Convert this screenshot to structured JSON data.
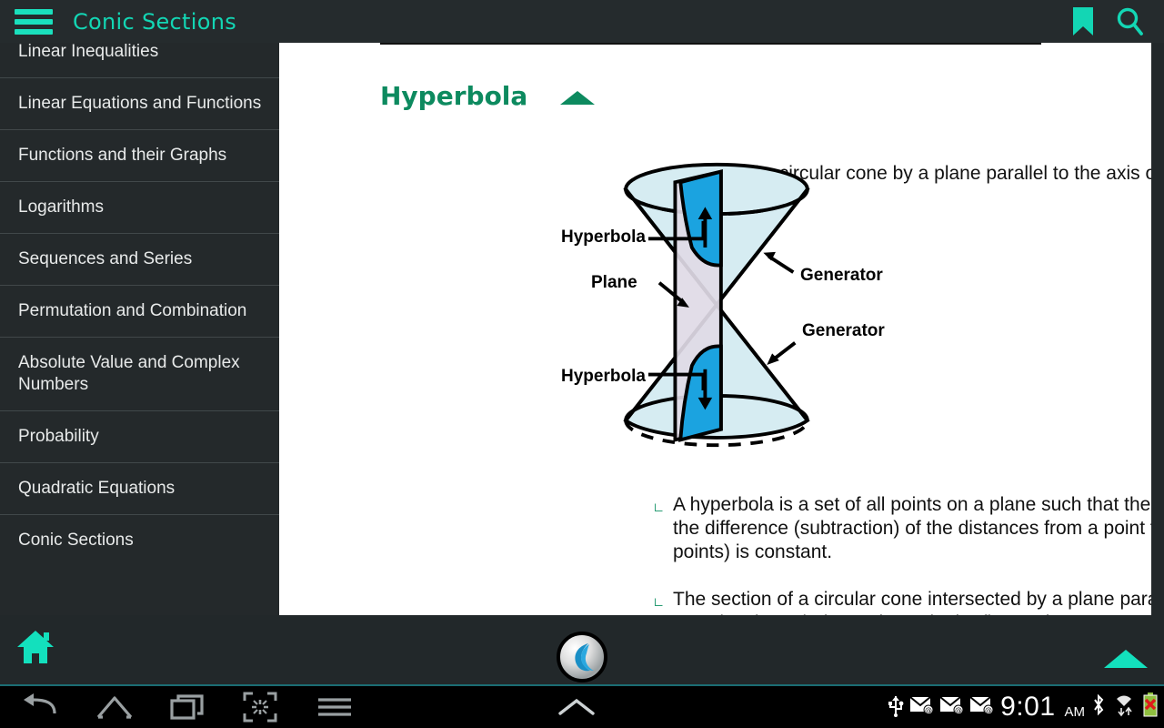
{
  "app": {
    "title": "Conic Sections",
    "accent": "#13d6b4",
    "menu_icon": "hamburger-icon",
    "bookmark_icon": "bookmark-icon",
    "search_icon": "search-icon"
  },
  "sidebar": {
    "items": [
      {
        "label": "Linear Inequalities"
      },
      {
        "label": "Linear Equations and Functions"
      },
      {
        "label": "Functions and their Graphs"
      },
      {
        "label": "Logarithms"
      },
      {
        "label": "Sequences and Series"
      },
      {
        "label": "Permutation and Combination"
      },
      {
        "label": "Absolute Value and Complex Numbers"
      },
      {
        "label": "Probability"
      },
      {
        "label": "Quadratic Equations"
      },
      {
        "label": "Conic Sections"
      }
    ]
  },
  "content": {
    "section_title": "Hyperbola",
    "section_title_color": "#0d8a5f",
    "collapse_icon": "triangle-up-icon",
    "bullets": [
      "Section of a circular cone by a plane parallel to the axis of the cone is a hyperbola.",
      "A hyperbola is a set of all points on a plane such that the absolute value of the difference (subtraction) of the distances from a point to the two foci (fixed points) is constant.",
      "The section of a circular cone intersected by a plane parallel to the axis of the cone is a hyperbola as shown in the figure above."
    ],
    "figure": {
      "alt": "double cone cut by a plane parallel to the axis producing two hyperbola branches",
      "labels": {
        "hyperbola_top": "Hyperbola",
        "plane": "Plane",
        "generator_top": "Generator",
        "generator_bottom": "Generator",
        "hyperbola_bottom": "Hyperbola"
      },
      "colors": {
        "cone_fill": "#d6ecf2",
        "section_fill": "#1ba3e0",
        "plane_fill": "#e0dae6",
        "outline": "#000000"
      }
    }
  },
  "bottombar": {
    "home_icon": "home-icon",
    "scroll_top_icon": "triangle-up-icon",
    "app_badge_icon": "crescent-logo-icon"
  },
  "navbar": {
    "items": [
      {
        "icon": "back-icon"
      },
      {
        "icon": "home-icon"
      },
      {
        "icon": "recents-icon"
      },
      {
        "icon": "screenshot-icon"
      },
      {
        "icon": "menu-icon"
      },
      {
        "icon": "chevron-up-icon"
      }
    ]
  },
  "statusbar": {
    "icons": [
      "usb-icon",
      "email-icon",
      "email-icon",
      "email-icon"
    ],
    "time": "9:01",
    "meridiem": "AM",
    "right_icons": [
      "bluetooth-icon",
      "wifi-icon",
      "battery-error-icon"
    ]
  }
}
